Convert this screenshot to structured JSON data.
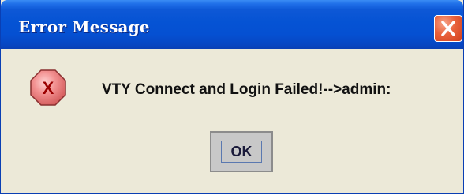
{
  "window": {
    "title": "Error Message"
  },
  "titlebar": {
    "close_icon": "close-icon"
  },
  "dialog": {
    "icon": "error-icon",
    "icon_glyph": "X",
    "message": "VTY Connect and Login Failed!-->admin:",
    "ok_label": "OK"
  },
  "colors": {
    "titlebar_blue": "#0553d4",
    "close_red": "#e8613b",
    "dialog_bg": "#ece9d8",
    "error_icon_fill": "#f08080",
    "error_icon_glyph": "#9b0000",
    "button_bg": "#c8c8c8"
  }
}
